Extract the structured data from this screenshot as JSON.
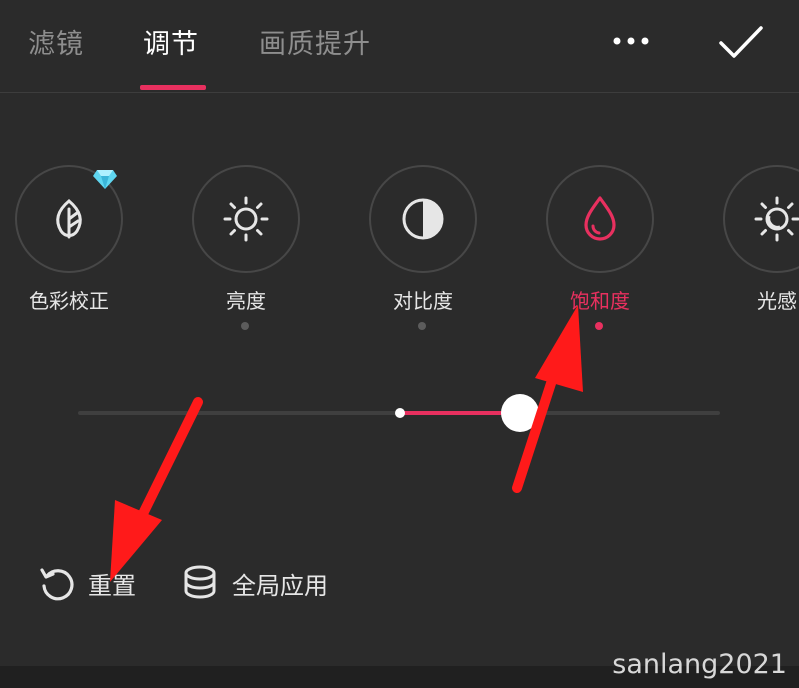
{
  "tabs": [
    {
      "label": "滤镜"
    },
    {
      "label": "调节"
    },
    {
      "label": "画质提升"
    }
  ],
  "active_tab": "调节",
  "accent_color": "#e8305f",
  "tools": [
    {
      "label": "色彩校正",
      "icon": "leaf-icon",
      "premium": true
    },
    {
      "label": "亮度",
      "icon": "sun-icon"
    },
    {
      "label": "对比度",
      "icon": "contrast-icon"
    },
    {
      "label": "饱和度",
      "icon": "droplet-icon",
      "active": true
    },
    {
      "label": "光感",
      "icon": "light-sense-icon"
    }
  ],
  "slider": {
    "value": 0.5,
    "min": -1,
    "max": 1
  },
  "actions": {
    "reset_label": "重置",
    "apply_all_label": "全局应用"
  },
  "watermark": "sanlang2021"
}
